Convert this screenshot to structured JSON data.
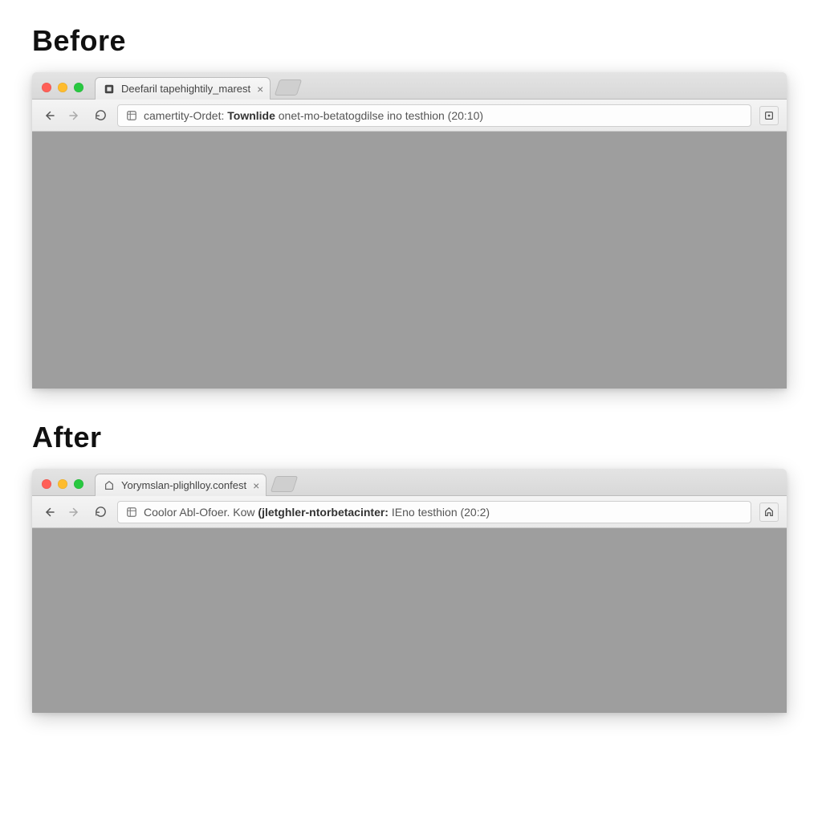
{
  "labels": {
    "before": "Before",
    "after": "After"
  },
  "before": {
    "tab": {
      "title": "Deefaril tapehightily_marest"
    },
    "url": {
      "pre": "camertity-Ordet: ",
      "strong": "Townlide ",
      "post": "onet-mo-betatogdilse ino testhion (20:10)"
    }
  },
  "after": {
    "tab": {
      "title": "Yorymslan-plighlloy.confest"
    },
    "url": {
      "pre": "Coolor Abl-Ofoer. Kow ",
      "strong": "(jletghler-ntorbetacinter: ",
      "post": "IEno testhion (20:2)"
    }
  }
}
